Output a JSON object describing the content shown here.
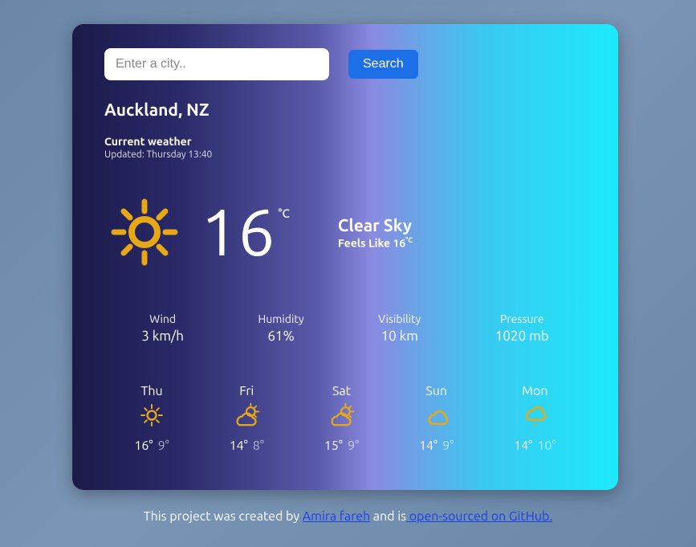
{
  "search": {
    "placeholder": "Enter a city..",
    "button": "Search"
  },
  "location": "Auckland, NZ",
  "current": {
    "heading": "Current weather",
    "updated": "Updated: Thursday 13:40",
    "temp": "16",
    "unit": "°C",
    "condition": "Clear Sky",
    "feels_prefix": "Feels Like ",
    "feels_value": "16",
    "feels_unit": "°C"
  },
  "stats": {
    "wind": {
      "label": "Wind",
      "value": "3 km/h"
    },
    "humidity": {
      "label": "Humidity",
      "value": "61%"
    },
    "visibility": {
      "label": "Visibility",
      "value": "10 km"
    },
    "pressure": {
      "label": "Pressure",
      "value": "1020 mb"
    }
  },
  "forecast": [
    {
      "day": "Thu",
      "icon": "sun",
      "hi": "16°",
      "lo": "9°"
    },
    {
      "day": "Fri",
      "icon": "sun-cloud",
      "hi": "14°",
      "lo": "8°"
    },
    {
      "day": "Sat",
      "icon": "sun-cloud",
      "hi": "15°",
      "lo": "9°"
    },
    {
      "day": "Sun",
      "icon": "cloud",
      "hi": "14°",
      "lo": "9°"
    },
    {
      "day": "Mon",
      "icon": "cloud-rain",
      "hi": "14°",
      "lo": "10°"
    }
  ],
  "footer": {
    "prefix": "This project was created by ",
    "author": "Amira fareh",
    "mid": " and is",
    "link": " open-sourced on GitHub."
  },
  "colors": {
    "accent": "#e6a817",
    "button": "#1d6fe8"
  }
}
